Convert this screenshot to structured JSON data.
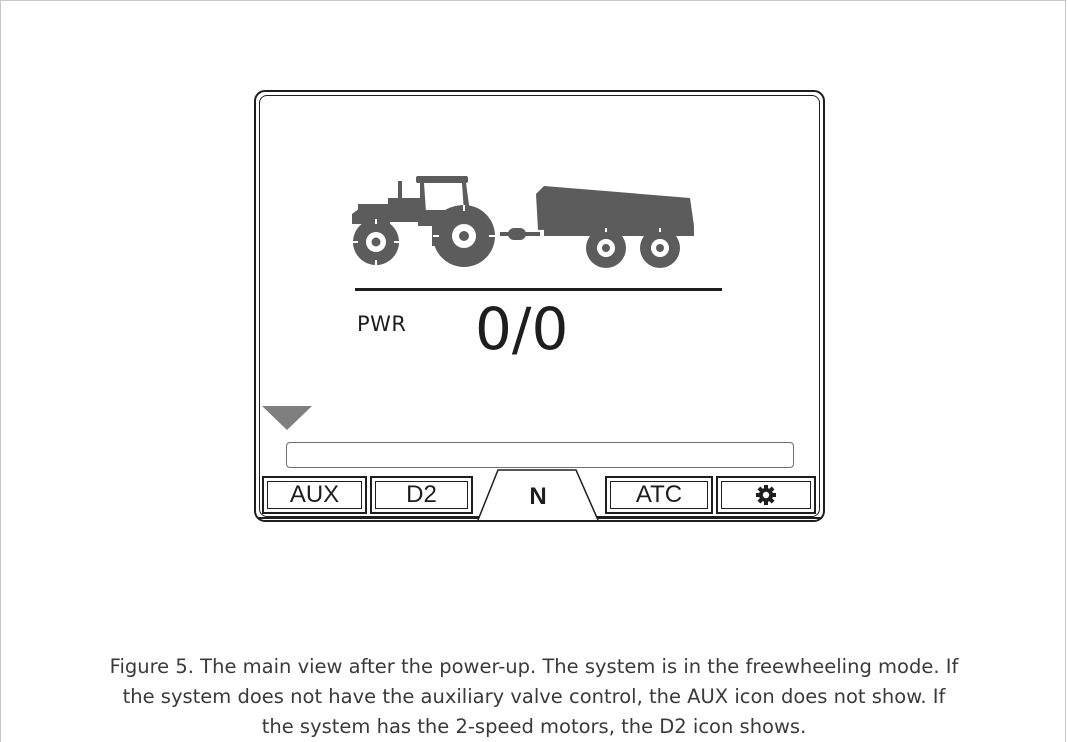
{
  "display": {
    "power_label": "PWR",
    "power_value": "0/0",
    "progress_fraction": 0,
    "mode_tabs": [
      {
        "label": "AUX"
      },
      {
        "label": "D2"
      },
      {
        "label": "N",
        "selected": true
      },
      {
        "label": "ATC"
      },
      {
        "label": "",
        "icon": "gear-icon"
      }
    ],
    "colors": {
      "outline": "#1e1e1e",
      "illustration_fill": "#5c5c5c",
      "pointer": "#7f7f7f",
      "caption_text": "#3a3a3a"
    }
  },
  "caption": {
    "line1": "Figure 5. The main view after the power-up. The system is in the freewheeling mode. If",
    "line2": "the system does not have the auxiliary valve control, the AUX icon does not show. If",
    "line3": "the system has the 2-speed motors, the D2 icon shows."
  }
}
